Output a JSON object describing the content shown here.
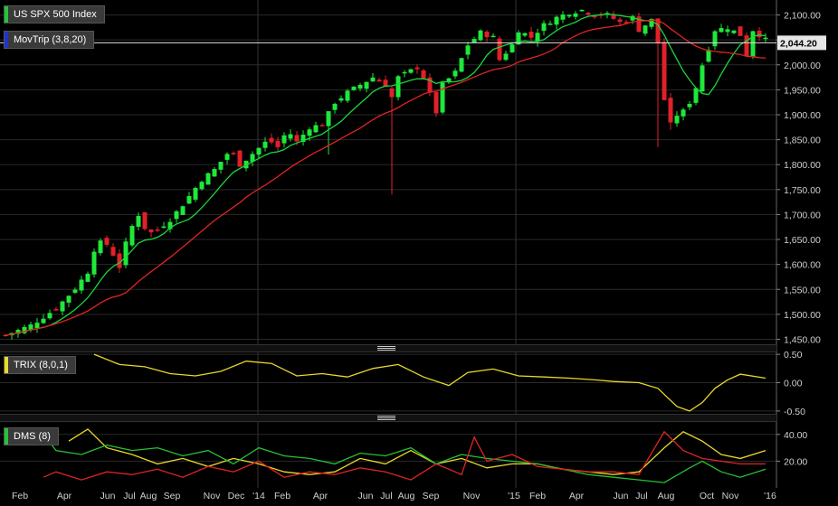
{
  "legends": {
    "price": {
      "label": "US SPX 500 Index",
      "color": "#22c43a"
    },
    "movtrip": {
      "label": "MovTrip (3,8,20)",
      "color": "#2233cc"
    },
    "trix": {
      "label": "TRIX (8,0,1)",
      "color": "#e8d92a"
    },
    "dms": {
      "label": "DMS (8)",
      "color": "#22c43a"
    }
  },
  "colors": {
    "up": "#1ee83a",
    "down": "#e2202a",
    "ma_fast": "#19d63a",
    "ma_slow": "#e02424",
    "trix": "#e8d92a",
    "dms_plus": "#25c233",
    "dms_minus": "#e02424",
    "adx": "#e8d92a",
    "grid": "#2a2a2a",
    "axis_text": "#cfcfcf",
    "last_price_bg": "#e6e6e6"
  },
  "chart_data": [
    {
      "type": "candlestick",
      "title": "US SPX 500 Index",
      "ylim": [
        1440,
        2130
      ],
      "y_ticks": [
        "1,450.00",
        "1,500.00",
        "1,550.00",
        "1,600.00",
        "1,650.00",
        "1,700.00",
        "1,750.00",
        "1,800.00",
        "1,850.00",
        "1,900.00",
        "1,950.00",
        "2,000.00",
        "2,050.00",
        "2,100.00"
      ],
      "last_price": "2,044.20",
      "x_labels": [
        "Feb",
        "Apr",
        "Jun",
        "Jul",
        "Aug",
        "Sep",
        "Nov",
        "Dec",
        "'14",
        "Feb",
        "Apr",
        "Jun",
        "Jul",
        "Aug",
        "Sep",
        "Nov",
        "'15",
        "Feb",
        "Apr",
        "Jun",
        "Jul",
        "Aug",
        "Oct",
        "Nov",
        "'16"
      ],
      "close_path": [
        [
          0,
          1458
        ],
        [
          4,
          1478
        ],
        [
          8,
          1512
        ],
        [
          11,
          1552
        ],
        [
          13,
          1585
        ],
        [
          14,
          1630
        ],
        [
          15.5,
          1650
        ],
        [
          17,
          1620
        ],
        [
          18,
          1595
        ],
        [
          19.5,
          1665
        ],
        [
          21,
          1700
        ],
        [
          22.5,
          1660
        ],
        [
          24,
          1670
        ],
        [
          26,
          1690
        ],
        [
          28,
          1720
        ],
        [
          31,
          1770
        ],
        [
          33,
          1790
        ],
        [
          35.5,
          1830
        ],
        [
          37,
          1800
        ],
        [
          39,
          1822
        ],
        [
          41.5,
          1850
        ],
        [
          43,
          1835
        ],
        [
          44.5,
          1870
        ],
        [
          46,
          1845
        ],
        [
          48,
          1875
        ],
        [
          50,
          1880
        ],
        [
          52,
          1925
        ],
        [
          54,
          1945
        ],
        [
          56,
          1960
        ],
        [
          58,
          1975
        ],
        [
          60,
          1960
        ],
        [
          61,
          1935
        ],
        [
          62,
          1975
        ],
        [
          65,
          1995
        ],
        [
          66,
          1975
        ],
        [
          68,
          1905
        ],
        [
          69,
          1960
        ],
        [
          71,
          1985
        ],
        [
          73,
          2040
        ],
        [
          75,
          2065
        ],
        [
          77,
          2055
        ],
        [
          78,
          2010
        ],
        [
          80,
          2040
        ],
        [
          81,
          2070
        ],
        [
          83,
          2055
        ],
        [
          85,
          2080
        ],
        [
          87,
          2095
        ],
        [
          89,
          2105
        ],
        [
          91,
          2110
        ],
        [
          93,
          2100
        ],
        [
          95,
          2100
        ],
        [
          97,
          2085
        ],
        [
          99,
          2095
        ],
        [
          100,
          2070
        ],
        [
          102,
          2090
        ],
        [
          103.5,
          2020
        ],
        [
          104,
          1930
        ],
        [
          105,
          1880
        ],
        [
          106,
          1900
        ],
        [
          107.5,
          1910
        ],
        [
          109,
          1955
        ],
        [
          110,
          2000
        ],
        [
          112,
          2070
        ],
        [
          114,
          2075
        ],
        [
          116,
          2060
        ],
        [
          117,
          2020
        ],
        [
          118,
          2070
        ],
        [
          120,
          2050
        ]
      ],
      "wicks": [
        {
          "x": 51,
          "low": 1820
        },
        {
          "x": 61,
          "low": 1740
        },
        {
          "x": 103,
          "low": 1835
        },
        {
          "x": 105,
          "low": 1870
        }
      ],
      "n_candles": 120
    },
    {
      "type": "line",
      "title": "TRIX (8,0,1)",
      "ylim": [
        -0.55,
        0.55
      ],
      "y_ticks": [
        "0.50",
        "0.00",
        "-0.50"
      ],
      "points": [
        [
          14,
          0.5
        ],
        [
          18,
          0.32
        ],
        [
          22,
          0.28
        ],
        [
          26,
          0.16
        ],
        [
          30,
          0.12
        ],
        [
          34,
          0.2
        ],
        [
          38,
          0.38
        ],
        [
          42,
          0.34
        ],
        [
          46,
          0.12
        ],
        [
          50,
          0.16
        ],
        [
          54,
          0.1
        ],
        [
          58,
          0.25
        ],
        [
          62,
          0.32
        ],
        [
          66,
          0.1
        ],
        [
          70,
          -0.05
        ],
        [
          73,
          0.18
        ],
        [
          77,
          0.24
        ],
        [
          81,
          0.12
        ],
        [
          85,
          0.1
        ],
        [
          89,
          0.08
        ],
        [
          93,
          0.05
        ],
        [
          96,
          0.02
        ],
        [
          100,
          0.0
        ],
        [
          103,
          -0.1
        ],
        [
          106,
          -0.42
        ],
        [
          108,
          -0.5
        ],
        [
          110,
          -0.35
        ],
        [
          112,
          -0.1
        ],
        [
          114,
          0.05
        ],
        [
          116,
          0.15
        ],
        [
          120,
          0.08
        ]
      ]
    },
    {
      "type": "line",
      "title": "DMS (8)",
      "ylim": [
        0,
        50
      ],
      "y_ticks": [
        "40.00",
        "20.00"
      ],
      "series": [
        {
          "points": [
            [
              10,
              35
            ],
            [
              13,
              44
            ],
            [
              16,
              30
            ],
            [
              20,
              25
            ],
            [
              24,
              18
            ],
            [
              28,
              22
            ],
            [
              32,
              16
            ],
            [
              36,
              22
            ],
            [
              40,
              18
            ],
            [
              44,
              12
            ],
            [
              48,
              10
            ],
            [
              52,
              12
            ],
            [
              56,
              22
            ],
            [
              60,
              18
            ],
            [
              64,
              28
            ],
            [
              68,
              18
            ],
            [
              72,
              22
            ],
            [
              76,
              15
            ],
            [
              80,
              18
            ],
            [
              84,
              18
            ],
            [
              88,
              14
            ],
            [
              92,
              12
            ],
            [
              96,
              10
            ],
            [
              100,
              12
            ],
            [
              104,
              30
            ],
            [
              107,
              42
            ],
            [
              110,
              35
            ],
            [
              113,
              25
            ],
            [
              116,
              22
            ],
            [
              120,
              28
            ]
          ]
        },
        {
          "points": [
            [
              6,
              40
            ],
            [
              8,
              28
            ],
            [
              12,
              25
            ],
            [
              16,
              32
            ],
            [
              20,
              28
            ],
            [
              24,
              30
            ],
            [
              28,
              24
            ],
            [
              32,
              28
            ],
            [
              36,
              18
            ],
            [
              40,
              30
            ],
            [
              44,
              24
            ],
            [
              48,
              22
            ],
            [
              52,
              18
            ],
            [
              56,
              26
            ],
            [
              60,
              24
            ],
            [
              64,
              30
            ],
            [
              68,
              18
            ],
            [
              72,
              25
            ],
            [
              76,
              22
            ],
            [
              80,
              20
            ],
            [
              84,
              18
            ],
            [
              88,
              14
            ],
            [
              92,
              10
            ],
            [
              96,
              8
            ],
            [
              100,
              6
            ],
            [
              104,
              4
            ],
            [
              108,
              15
            ],
            [
              110,
              20
            ],
            [
              113,
              12
            ],
            [
              116,
              8
            ],
            [
              120,
              14
            ]
          ]
        },
        {
          "points": [
            [
              6,
              8
            ],
            [
              8,
              12
            ],
            [
              12,
              6
            ],
            [
              16,
              12
            ],
            [
              20,
              10
            ],
            [
              24,
              14
            ],
            [
              28,
              8
            ],
            [
              32,
              16
            ],
            [
              36,
              12
            ],
            [
              40,
              20
            ],
            [
              44,
              8
            ],
            [
              48,
              12
            ],
            [
              52,
              10
            ],
            [
              56,
              15
            ],
            [
              60,
              12
            ],
            [
              64,
              6
            ],
            [
              68,
              18
            ],
            [
              72,
              10
            ],
            [
              74,
              38
            ],
            [
              76,
              20
            ],
            [
              80,
              25
            ],
            [
              84,
              16
            ],
            [
              88,
              14
            ],
            [
              92,
              12
            ],
            [
              96,
              12
            ],
            [
              100,
              10
            ],
            [
              104,
              42
            ],
            [
              107,
              28
            ],
            [
              110,
              22
            ],
            [
              113,
              20
            ],
            [
              116,
              18
            ],
            [
              120,
              18
            ]
          ]
        }
      ]
    }
  ]
}
